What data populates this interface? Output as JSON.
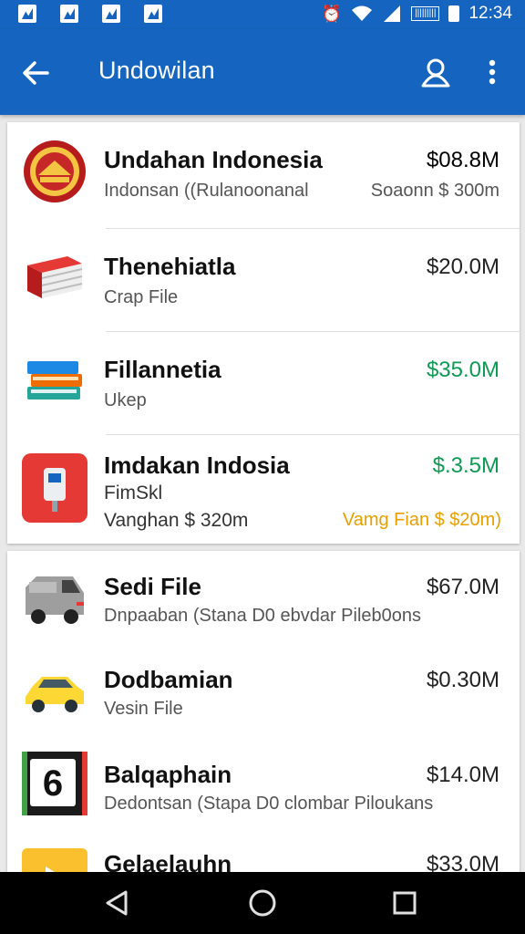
{
  "status_bar": {
    "time": "12:34",
    "indicator_box": "|||||||||",
    "left_icons": [
      "gallery-icon",
      "image-icon",
      "check-image-icon",
      "photo-icon"
    ],
    "right_icons": [
      "alarm-icon",
      "wifi-icon",
      "signal-icon",
      "battery-icon"
    ]
  },
  "app_bar": {
    "title": "Undowilan",
    "color": "#1565c0"
  },
  "list_group_1": [
    {
      "icon": "emblem-icon",
      "title": "Undahan Indonesia",
      "subtitle": "Indonsan ((Rulanoonanal",
      "side_note": "Soaonn $ 300m",
      "amount": "$08.8M",
      "amount_color": "#0e9a55"
    },
    {
      "icon": "red-book-icon",
      "title": "Thenehiatla",
      "subtitle": "Crap File",
      "amount": "$20.0M",
      "amount_color": "#222222"
    },
    {
      "icon": "book-stack-icon",
      "title": "Fillannetia",
      "subtitle": "Ukep",
      "amount": "$35.0M",
      "amount_color": "#0e9a55"
    },
    {
      "icon": "red-device-icon",
      "title": "Imdakan Indosia",
      "subtitle": "FimSkl",
      "subtitle2": "Vanghan $ 320m",
      "side_note": "Vamg Fian $ $20m)",
      "amount": "$.3.5M",
      "amount_color": "#0e9a55"
    }
  ],
  "list_group_2": [
    {
      "icon": "van-icon",
      "title": "Sedi File",
      "subtitle": "Dnpaaban (Stana D0 ebvdar Pileb0ons",
      "amount": "$67.0M"
    },
    {
      "icon": "yellow-car-icon",
      "title": "Dodbamian",
      "subtitle": "Vesin File",
      "amount": "$0.30M"
    },
    {
      "icon": "number-six-tile-icon",
      "title": "Balqaphain",
      "subtitle": "Dedontsan (Stapa D0 clombar Piloukans",
      "amount": "$14.0M",
      "tile_digit": "6"
    },
    {
      "icon": "play-tile-icon",
      "title": "Gelaelauhn",
      "amount": "$33.0M"
    }
  ],
  "nav_bar": {
    "buttons": [
      "back-nav-icon",
      "home-nav-icon",
      "recents-nav-icon"
    ]
  }
}
